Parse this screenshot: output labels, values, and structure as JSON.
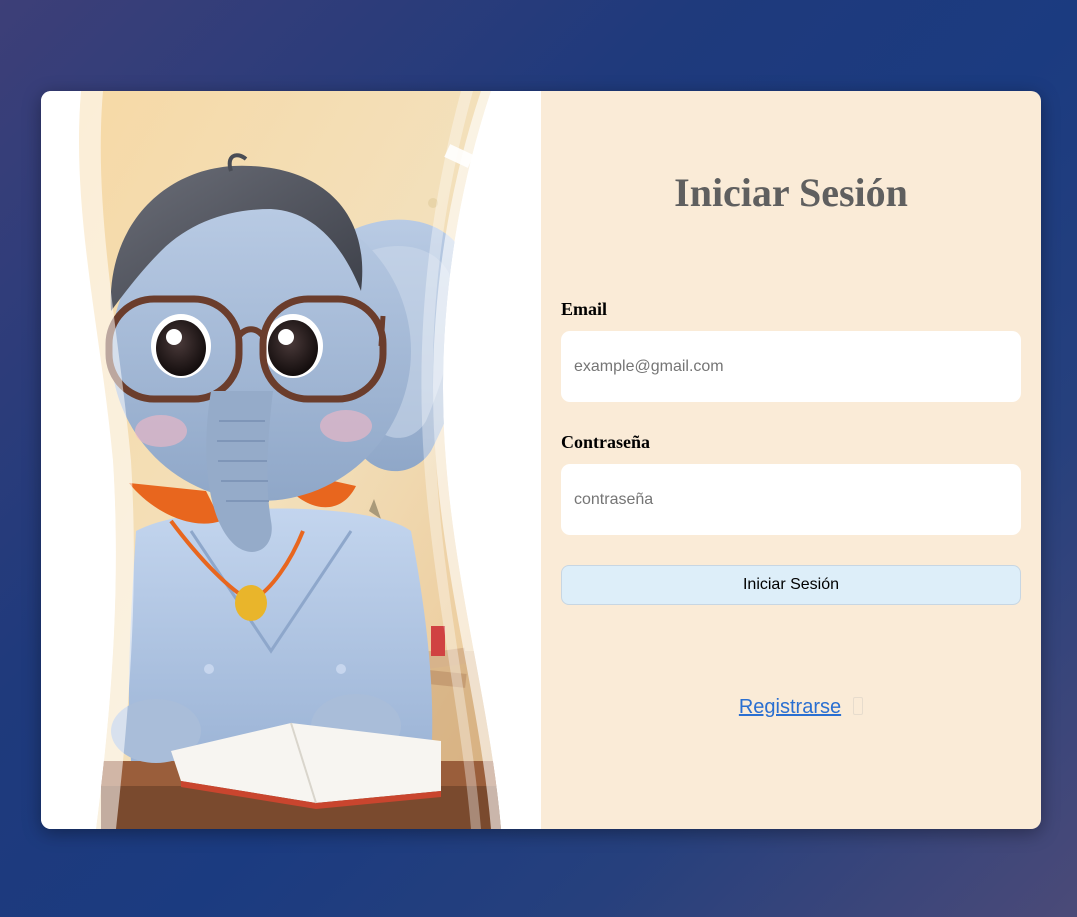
{
  "login": {
    "title": "Iniciar Sesión",
    "email_label": "Email",
    "email_placeholder": "example@gmail.com",
    "email_value": "",
    "password_label": "Contraseña",
    "password_placeholder": "contraseña",
    "password_value": "",
    "submit_label": "Iniciar Sesión",
    "register_label": "Registrarse",
    "register_icon": "broken-image-icon"
  },
  "illustration": {
    "icon": "elephant-reading-illustration"
  },
  "colors": {
    "page_bg_start": "#3d3f78",
    "page_bg_mid": "#1b3b80",
    "form_panel_bg": "#faebd7",
    "title_color": "#5f5f5f",
    "button_bg": "#ddeef9",
    "link_color": "#2a6fd1"
  }
}
